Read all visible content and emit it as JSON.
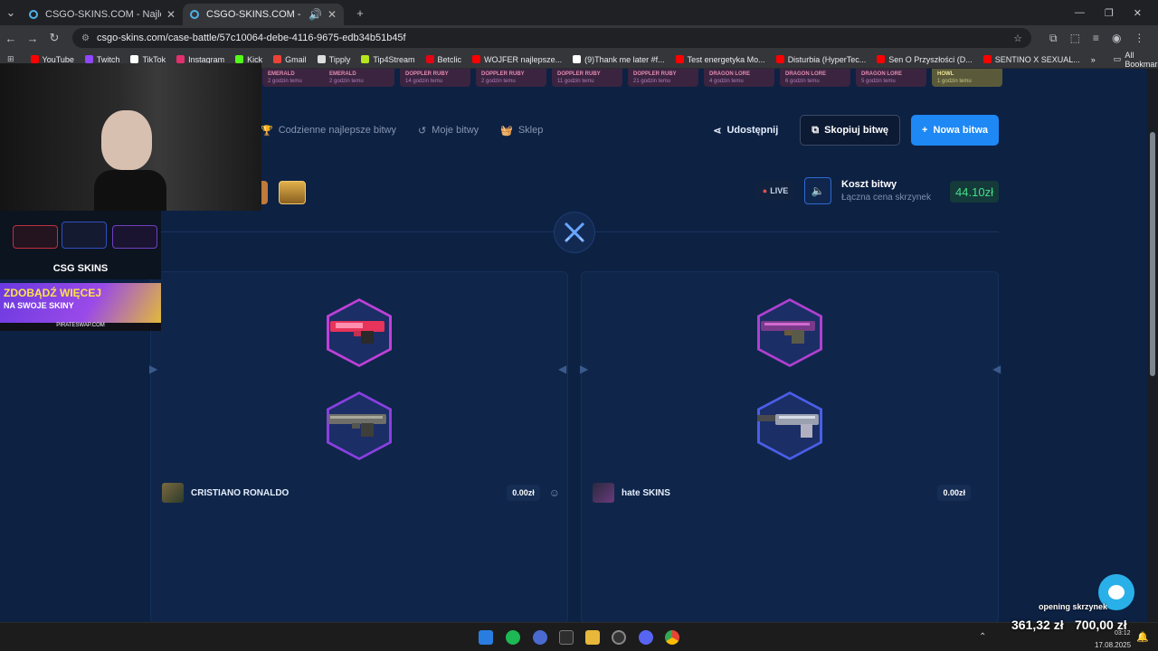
{
  "browser": {
    "tabs": [
      {
        "title": "CSGO-SKINS.COM - Najlepsze",
        "active": false
      },
      {
        "title": "CSGO-SKINS.COM - Najlep",
        "active": true
      }
    ],
    "url": "csgo-skins.com/case-battle/57c10064-debe-4116-9675-edb34b51b45f",
    "bookmarks": [
      {
        "label": "YouTube",
        "color": "#ff0000"
      },
      {
        "label": "Twitch",
        "color": "#9146ff"
      },
      {
        "label": "TikTok",
        "color": "#ffffff"
      },
      {
        "label": "Instagram",
        "color": "#e1306c"
      },
      {
        "label": "Kick",
        "color": "#53fc18"
      },
      {
        "label": "Gmail",
        "color": "#ea4335"
      },
      {
        "label": "Tipply",
        "color": "#dddddd"
      },
      {
        "label": "Tip4Stream",
        "color": "#b5e61d"
      },
      {
        "label": "Betclic",
        "color": "#e30613"
      },
      {
        "label": "WOJFER najlepsze...",
        "color": "#ff0000"
      },
      {
        "label": "(9)Thank me later #f...",
        "color": "#ffffff"
      },
      {
        "label": "Test energetyka Mo...",
        "color": "#ff0000"
      },
      {
        "label": "Disturbia (HyperTec...",
        "color": "#ff0000"
      },
      {
        "label": "Sen O Przyszłości (D...",
        "color": "#ff0000"
      },
      {
        "label": "SENTINO X SEXUAL...",
        "color": "#ff0000"
      }
    ],
    "all_bookmarks": "All Bookmarks"
  },
  "overlay": {
    "brand": "CSG SKINS",
    "promo_line1": "ZDOBĄDŹ WIĘCEJ",
    "promo_line2": "NA SWOJE SKINY",
    "promo_site": "PIRATESWAP.COM"
  },
  "nav": {
    "daily": "Codzienne najlepsze bitwy",
    "mine": "Moje bitwy",
    "shop": "Sklep",
    "share": "Udostępnij",
    "copy": "Skopiuj bitwę",
    "new": "Nowa bitwa"
  },
  "battle": {
    "live": "LIVE",
    "cost_title": "Koszt bitwy",
    "cost_sub": "Łączna cena skrzynek",
    "cost_value": "44.10zł"
  },
  "players": [
    {
      "name": "CRISTIANO RONALDO",
      "value": "0.00zł"
    },
    {
      "name": "hate SKINS",
      "value": "0.00zł"
    }
  ],
  "stream": {
    "label": "opening skrzynek",
    "balance1": "361,32 zł",
    "balance2": "700,00 zł"
  },
  "clock": {
    "time": "03:12",
    "date": "17.08.2025"
  },
  "colors": {
    "accent": "#1e88f5",
    "green": "#46e08a",
    "bg": "#0d2143"
  }
}
